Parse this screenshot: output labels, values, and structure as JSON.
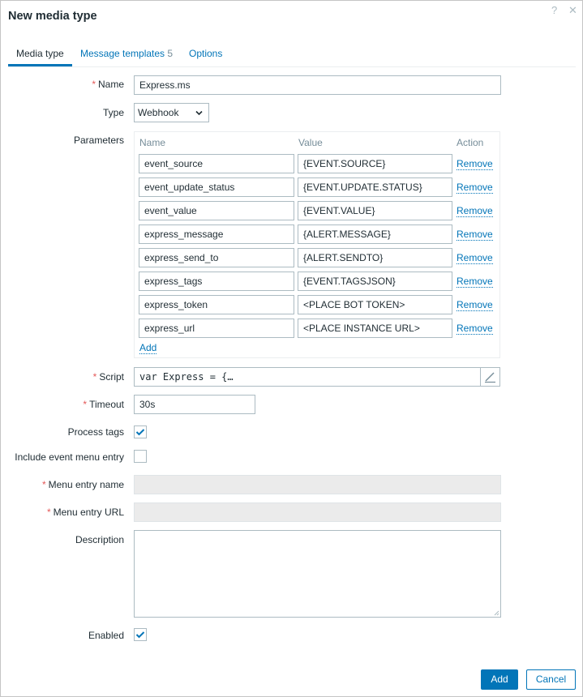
{
  "dialog": {
    "title": "New media type",
    "help_icon": "?",
    "close_icon": "✕"
  },
  "tabs": [
    {
      "label": "Media type",
      "active": true
    },
    {
      "label": "Message templates",
      "count": "5",
      "active": false
    },
    {
      "label": "Options",
      "active": false
    }
  ],
  "form": {
    "name_label": "Name",
    "name_value": "Express.ms",
    "type_label": "Type",
    "type_value": "Webhook",
    "parameters_label": "Parameters",
    "parameters": {
      "headers": {
        "name": "Name",
        "value": "Value",
        "action": "Action"
      },
      "rows": [
        {
          "name": "event_source",
          "value": "{EVENT.SOURCE}",
          "action": "Remove"
        },
        {
          "name": "event_update_status",
          "value": "{EVENT.UPDATE.STATUS}",
          "action": "Remove"
        },
        {
          "name": "event_value",
          "value": "{EVENT.VALUE}",
          "action": "Remove"
        },
        {
          "name": "express_message",
          "value": "{ALERT.MESSAGE}",
          "action": "Remove"
        },
        {
          "name": "express_send_to",
          "value": "{ALERT.SENDTO}",
          "action": "Remove"
        },
        {
          "name": "express_tags",
          "value": "{EVENT.TAGSJSON}",
          "action": "Remove"
        },
        {
          "name": "express_token",
          "value": "<PLACE BOT TOKEN>",
          "action": "Remove"
        },
        {
          "name": "express_url",
          "value": "<PLACE INSTANCE URL>",
          "action": "Remove"
        }
      ],
      "add_label": "Add"
    },
    "script_label": "Script",
    "script_value": "var Express = {…",
    "timeout_label": "Timeout",
    "timeout_value": "30s",
    "process_tags_label": "Process tags",
    "process_tags_checked": true,
    "include_event_menu_label": "Include event menu entry",
    "include_event_menu_checked": false,
    "menu_entry_name_label": "Menu entry name",
    "menu_entry_name_value": "",
    "menu_entry_url_label": "Menu entry URL",
    "menu_entry_url_value": "",
    "description_label": "Description",
    "description_value": "",
    "enabled_label": "Enabled",
    "enabled_checked": true,
    "required_marker": "*"
  },
  "footer": {
    "add_label": "Add",
    "cancel_label": "Cancel"
  },
  "colors": {
    "accent": "#0275b8",
    "required": "#e45959",
    "text": "#1f2c33",
    "muted": "#768d99"
  }
}
